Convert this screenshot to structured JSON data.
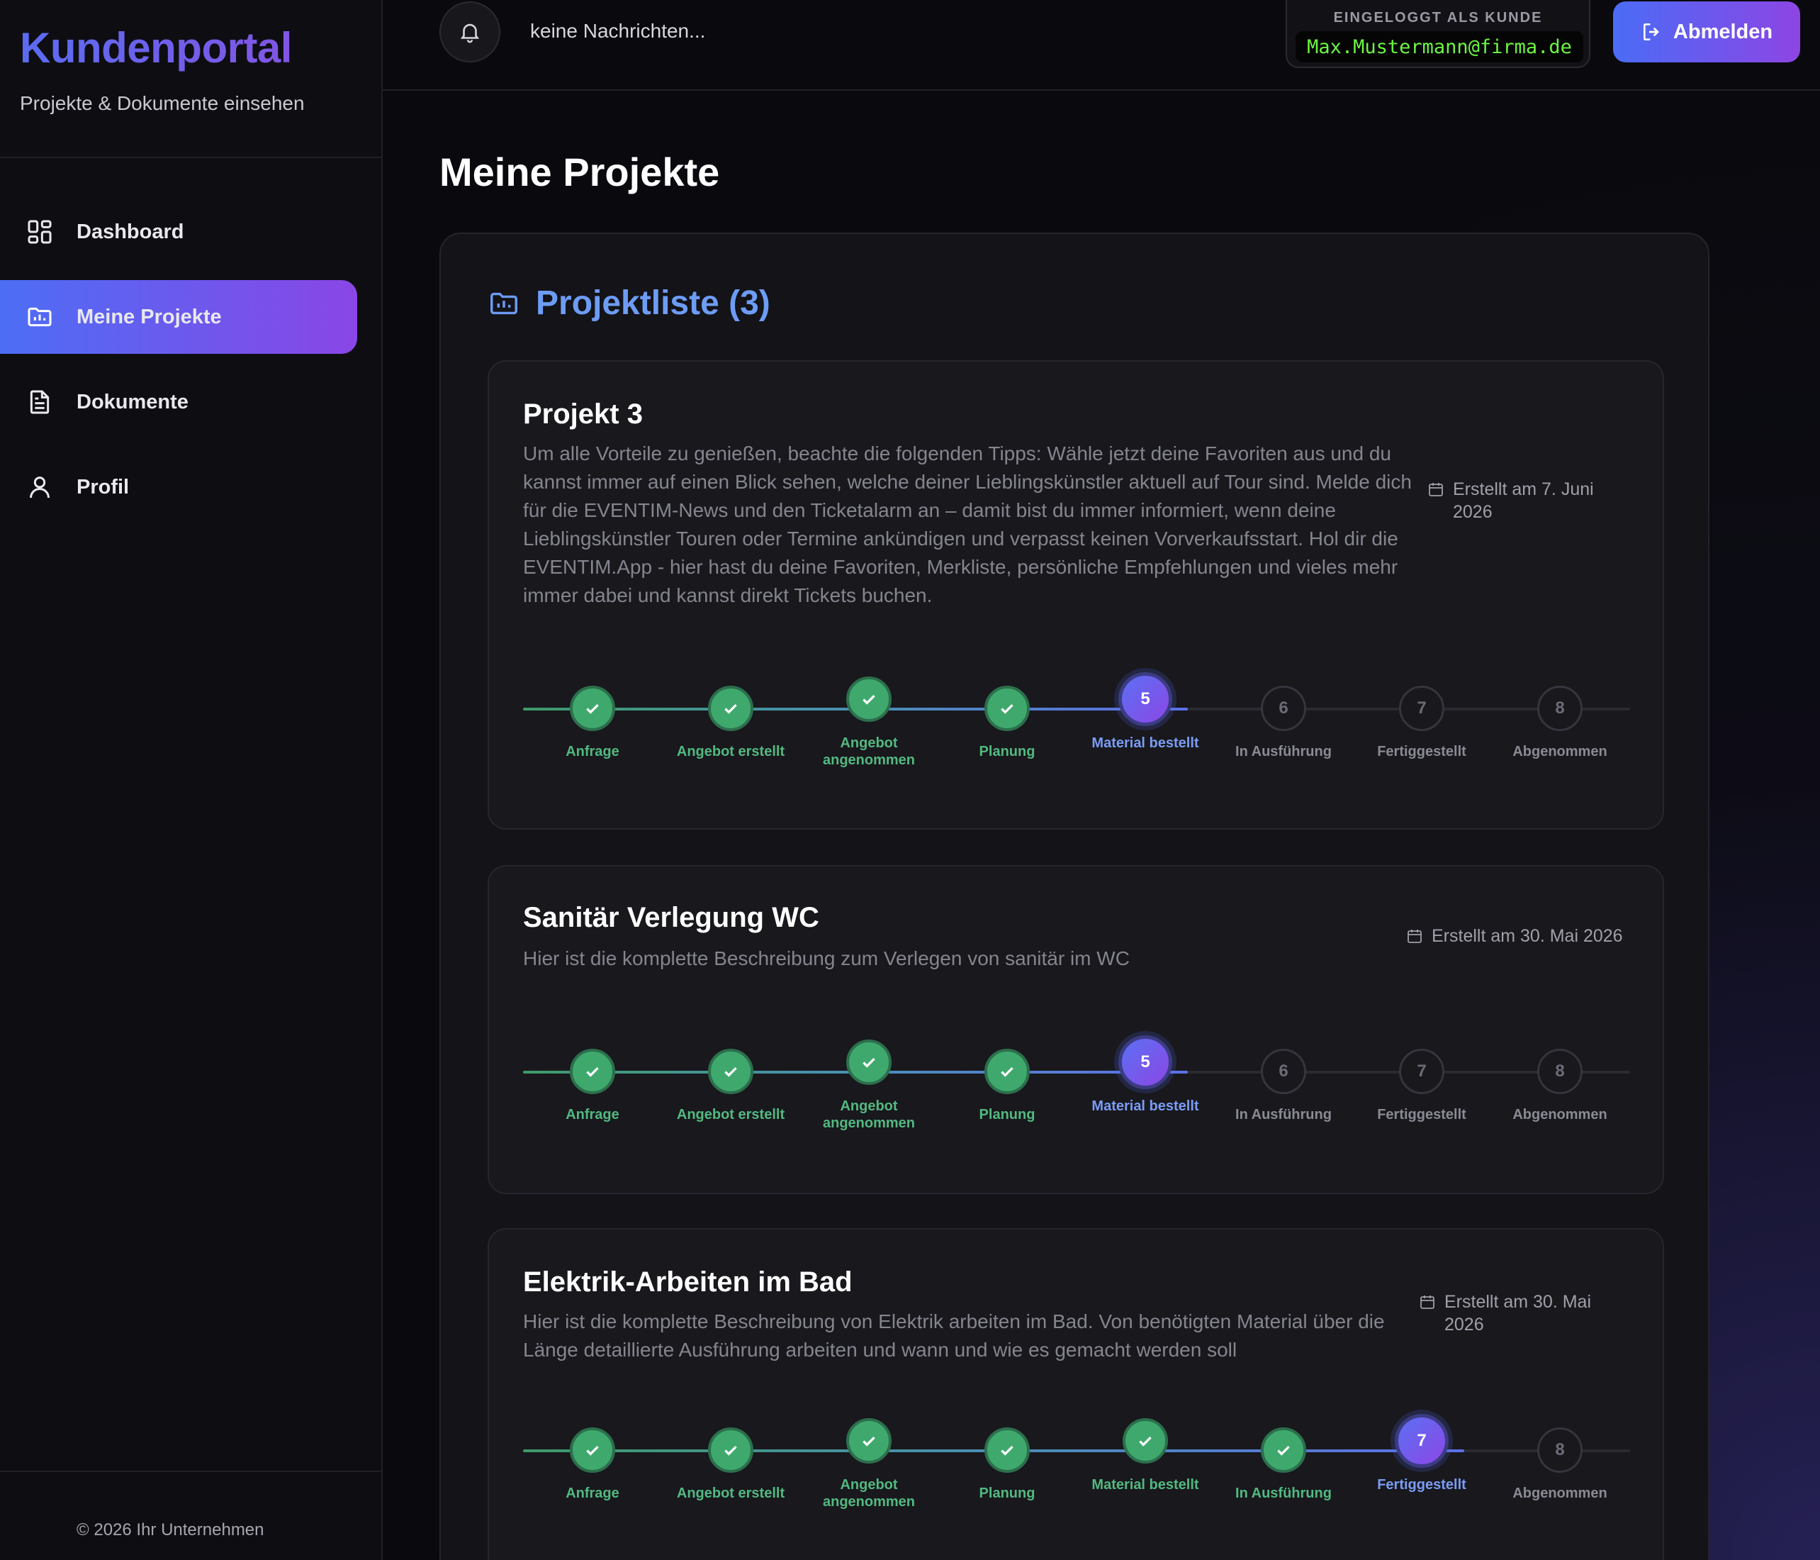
{
  "sidebar": {
    "brand_title": "Kundenportal",
    "brand_subtitle": "Projekte & Dokumente einsehen",
    "items": [
      {
        "label": "Dashboard",
        "icon": "grid-icon"
      },
      {
        "label": "Meine Projekte",
        "icon": "folder-chart-icon",
        "active": true
      },
      {
        "label": "Dokumente",
        "icon": "document-icon"
      },
      {
        "label": "Profil",
        "icon": "user-icon"
      }
    ],
    "footer": "© 2026 Ihr Unternehmen"
  },
  "topbar": {
    "notification_text": "keine Nachrichten...",
    "user_label": "EINGELOGGT ALS KUNDE",
    "user_email": "Max.Mustermann@firma.de",
    "logout_label": "Abmelden"
  },
  "colors": {
    "accent_start": "#4c6ef5",
    "accent_end": "#8a46e6",
    "done_green": "#3fa96d",
    "email_green": "#6cf542",
    "heading_blue": "#6d9cf5"
  },
  "main": {
    "page_title": "Meine Projekte",
    "panel_title": "Projektliste (3)",
    "steps": [
      "Anfrage",
      "Angebot erstellt",
      "Angebot angenommen",
      "Planung",
      "Material bestellt",
      "In Ausführung",
      "Fertiggestellt",
      "Abgenommen"
    ],
    "projects": [
      {
        "title": "Projekt 3",
        "description": "Um alle Vorteile zu genießen, beachte die folgenden Tipps: Wähle jetzt deine Favoriten aus und du kannst immer auf einen Blick sehen, welche deiner Lieblingskünstler aktuell auf Tour sind. Melde dich für die EVENTIM-News und den Ticketalarm an – damit bist du immer informiert, wenn deine Lieblingskünstler Touren oder Termine ankündigen und verpasst keinen Vorverkaufsstart. Hol dir die EVENTIM.App - hier hast du deine Favoriten, Merkliste, persönliche Empfehlungen und vieles mehr immer dabei und kannst direkt Tickets buchen.",
        "date": "Erstellt am 7. Juni 2026",
        "current_step": 5
      },
      {
        "title": "Sanitär Verlegung WC",
        "description": "Hier ist die komplette Beschreibung zum Verlegen von sanitär im WC",
        "date": "Erstellt am 30. Mai 2026",
        "current_step": 5
      },
      {
        "title": "Elektrik-Arbeiten im Bad",
        "description": "Hier ist die komplette Beschreibung von Elektrik arbeiten im Bad. Von benötigten Material über die Länge detaillierte Ausführung arbeiten und wann und wie es gemacht werden soll",
        "date": "Erstellt am 30. Mai 2026",
        "current_step": 7
      }
    ]
  }
}
